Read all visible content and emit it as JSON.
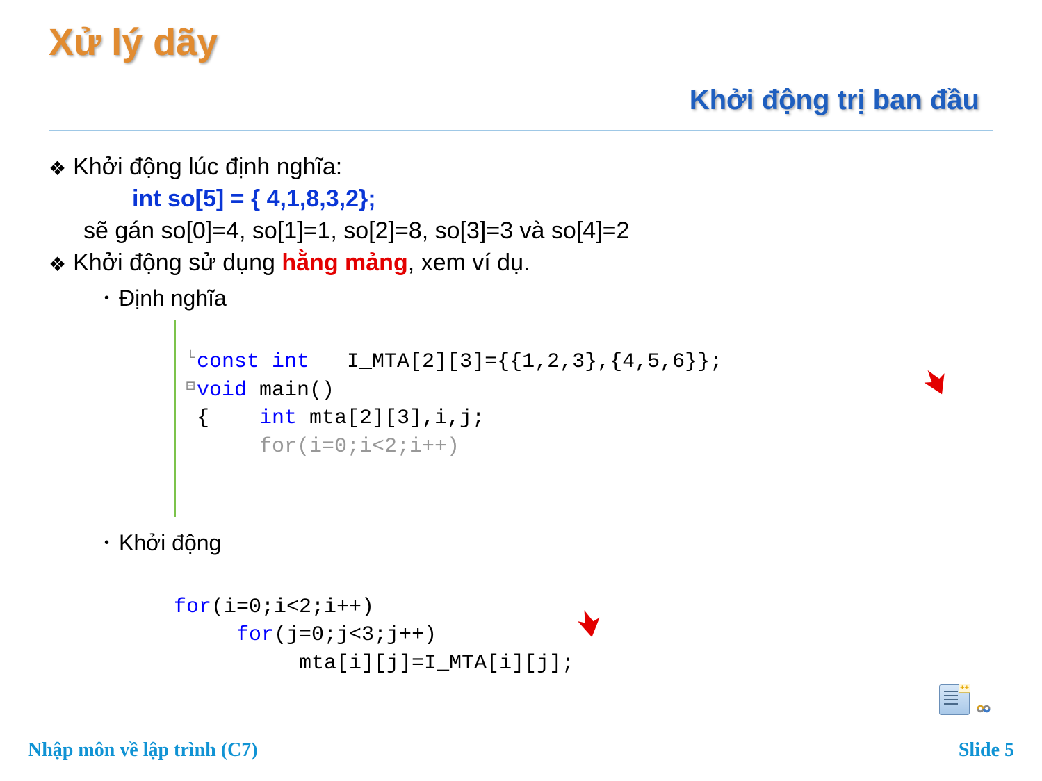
{
  "title": "Xử lý dãy",
  "subtitle": "Khởi động trị ban đầu",
  "bullets": {
    "b1": "Khởi động lúc định nghĩa:",
    "code_decl_kw": "int",
    "code_decl_rest": "  so[5] = { 4,1,8,3,2};",
    "explain": "sẽ gán so[0]=4, so[1]=1, so[2]=8, so[3]=3 và so[4]=2",
    "b2_pre": "Khởi động sử dụng ",
    "b2_red": "hằng mảng",
    "b2_post": ", xem ví dụ.",
    "sub1": "Định nghĩa",
    "sub2": "Khởi động"
  },
  "code1": {
    "l1_kw": "const int",
    "l1_rest": "   I_MTA[2][3]={{1,2,3},{4,5,6}};",
    "l2_kw": "void",
    "l2_rest": " main()",
    "l3_open": "{    ",
    "l3_kw": "int",
    "l3_rest": " mta[2][3],i,j;",
    "l4": "     for(i=0;i<2;i++)"
  },
  "code2": {
    "l1_kw": "for",
    "l1_rest": "(i=0;i<2;i++)",
    "l2_kw": "for",
    "l2_rest": "(j=0;j<3;j++)",
    "l3": "mta[i][j]=I_MTA[i][j];"
  },
  "footer": {
    "left": "Nhập môn về lập trình (C7)",
    "right": "Slide 5"
  },
  "icons": {
    "arrow1": "red-arrow-icon",
    "arrow2": "red-arrow-icon",
    "vs_doc": "visual-studio-cpp-file-icon",
    "vs_logo": "visual-studio-infinity-icon"
  }
}
